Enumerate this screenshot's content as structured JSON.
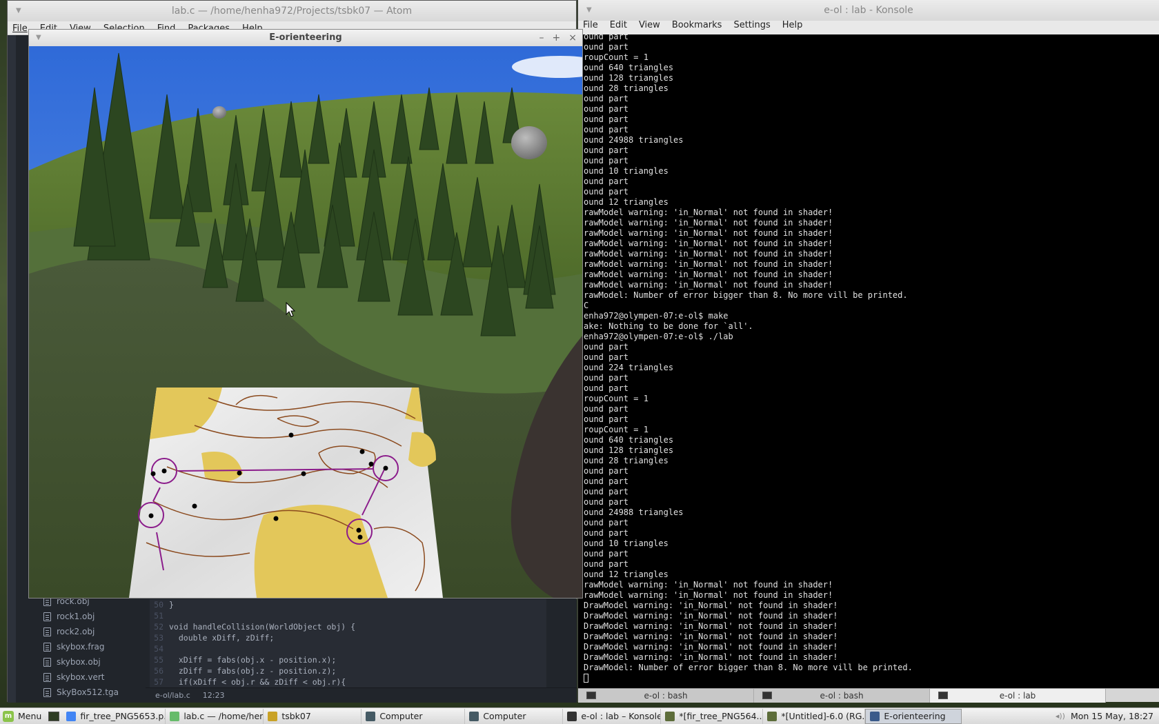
{
  "atom": {
    "title": "lab.c — /home/henha972/Projects/tsbk07 — Atom",
    "menu": [
      "File",
      "Edit",
      "View",
      "Selection",
      "Find",
      "Packages",
      "Help"
    ],
    "files": [
      "rock.obj",
      "rock1.obj",
      "rock2.obj",
      "skybox.frag",
      "skybox.obj",
      "skybox.vert",
      "SkyBox512.tga"
    ],
    "code_lines": [
      {
        "num": "50",
        "text": "}"
      },
      {
        "num": "51",
        "text": ""
      },
      {
        "num": "52",
        "text": "void handleCollision(WorldObject obj) {"
      },
      {
        "num": "53",
        "text": "  double xDiff, zDiff;"
      },
      {
        "num": "54",
        "text": ""
      },
      {
        "num": "55",
        "text": "  xDiff = fabs(obj.x - position.x);"
      },
      {
        "num": "56",
        "text": "  zDiff = fabs(obj.z - position.z);"
      },
      {
        "num": "57",
        "text": "  if(xDiff < obj.r && zDiff < obj.r){"
      }
    ],
    "status_path": "e-ol/lab.c",
    "status_pos": "12:23"
  },
  "konsole": {
    "title": "e-ol : lab - Konsole",
    "menu": [
      "File",
      "Edit",
      "View",
      "Bookmarks",
      "Settings",
      "Help"
    ],
    "lines": [
      "ound part",
      "ound part",
      "roupCount = 1",
      "ound 640 triangles",
      "ound 128 triangles",
      "ound 28 triangles",
      "ound part",
      "ound part",
      "ound part",
      "ound part",
      "ound 24988 triangles",
      "ound part",
      "ound part",
      "ound 10 triangles",
      "ound part",
      "ound part",
      "ound 12 triangles",
      "rawModel warning: 'in_Normal' not found in shader!",
      "rawModel warning: 'in_Normal' not found in shader!",
      "rawModel warning: 'in_Normal' not found in shader!",
      "rawModel warning: 'in_Normal' not found in shader!",
      "rawModel warning: 'in_Normal' not found in shader!",
      "rawModel warning: 'in_Normal' not found in shader!",
      "rawModel warning: 'in_Normal' not found in shader!",
      "rawModel warning: 'in_Normal' not found in shader!",
      "rawModel: Number of error bigger than 8. No more vill be printed.",
      "C",
      "enha972@olympen-07:e-ol$ make",
      "ake: Nothing to be done for `all'.",
      "enha972@olympen-07:e-ol$ ./lab",
      "ound part",
      "ound part",
      "ound 224 triangles",
      "ound part",
      "ound part",
      "roupCount = 1",
      "ound part",
      "ound part",
      "roupCount = 1",
      "ound 640 triangles",
      "ound 128 triangles",
      "ound 28 triangles",
      "ound part",
      "ound part",
      "ound part",
      "ound part",
      "ound 24988 triangles",
      "ound part",
      "ound part",
      "ound 10 triangles",
      "ound part",
      "ound part",
      "ound 12 triangles",
      "rawModel warning: 'in_Normal' not found in shader!",
      "rawModel warning: 'in_Normal' not found in shader!",
      "DrawModel warning: 'in_Normal' not found in shader!",
      "DrawModel warning: 'in_Normal' not found in shader!",
      "DrawModel warning: 'in_Normal' not found in shader!",
      "DrawModel warning: 'in_Normal' not found in shader!",
      "DrawModel warning: 'in_Normal' not found in shader!",
      "DrawModel warning: 'in_Normal' not found in shader!",
      "DrawModel: Number of error bigger than 8. No more vill be printed."
    ],
    "tabs": [
      {
        "label": "e-ol : bash",
        "active": false
      },
      {
        "label": "e-ol : bash",
        "active": false
      },
      {
        "label": "e-ol : lab",
        "active": true
      }
    ]
  },
  "game": {
    "title": "E-orienteering",
    "controls": [
      "–",
      "+",
      "×"
    ]
  },
  "taskbar": {
    "menu_label": "Menu",
    "tasks": [
      {
        "label": "fir_tree_PNG5653.p...",
        "icon_color": "#4285f4",
        "active": false
      },
      {
        "label": "lab.c — /home/hen...",
        "icon_color": "#66bb6a",
        "active": false
      },
      {
        "label": "tsbk07",
        "icon_color": "#c9a227",
        "active": false
      },
      {
        "label": "Computer",
        "icon_color": "#455a64",
        "active": false
      },
      {
        "label": "Computer",
        "icon_color": "#455a64",
        "active": false
      },
      {
        "label": "e-ol : lab – Konsole",
        "icon_color": "#333333",
        "active": false
      },
      {
        "label": "*[fir_tree_PNG564...",
        "icon_color": "#5d6d3a",
        "active": false
      },
      {
        "label": "*[Untitled]-6.0 (RG...",
        "icon_color": "#5d6d3a",
        "active": false
      },
      {
        "label": "E-orienteering",
        "icon_color": "#3a5a8a",
        "active": true
      }
    ],
    "clock": "Mon 15 May, 18:27"
  },
  "colors": {
    "accent_purple": "#8b1c8b",
    "contour_brown": "#8b4a1e",
    "map_yellow": "#e3c75a"
  }
}
